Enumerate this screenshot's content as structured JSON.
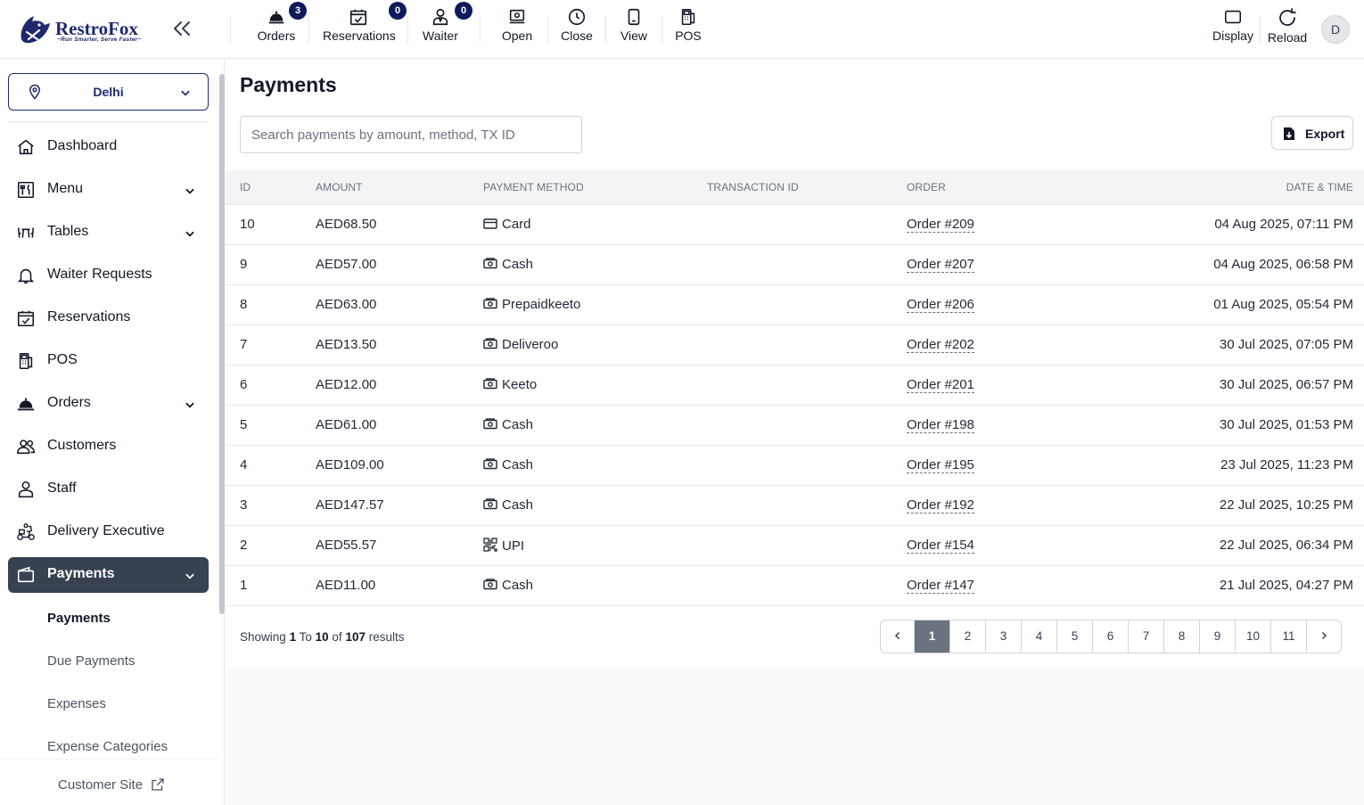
{
  "app": {
    "brand": "RestroFox",
    "tagline": "~Run Smarter, Serve Faster~"
  },
  "topbar": {
    "items": [
      {
        "label": "Orders",
        "icon": "bell-service-icon",
        "badge": "3"
      },
      {
        "label": "Reservations",
        "icon": "calendar-check-icon",
        "badge": "0"
      },
      {
        "label": "Waiter",
        "icon": "person-icon",
        "badge": "0"
      },
      {
        "label": "Open",
        "icon": "register-icon"
      },
      {
        "label": "Close",
        "icon": "clock-icon"
      },
      {
        "label": "View",
        "icon": "tablet-icon"
      },
      {
        "label": "POS",
        "icon": "pos-icon"
      }
    ],
    "display_label": "Display",
    "reload_label": "Reload",
    "avatar_initial": "D"
  },
  "sidebar": {
    "location": "Delhi",
    "items": [
      {
        "label": "Dashboard"
      },
      {
        "label": "Menu"
      },
      {
        "label": "Tables"
      },
      {
        "label": "Waiter Requests"
      },
      {
        "label": "Reservations"
      },
      {
        "label": "POS"
      },
      {
        "label": "Orders"
      },
      {
        "label": "Customers"
      },
      {
        "label": "Staff"
      },
      {
        "label": "Delivery Executive"
      },
      {
        "label": "Payments"
      }
    ],
    "sub_items": [
      {
        "label": "Payments"
      },
      {
        "label": "Due Payments"
      },
      {
        "label": "Expenses"
      },
      {
        "label": "Expense Categories"
      }
    ],
    "customer_site": "Customer Site"
  },
  "page": {
    "title": "Payments",
    "search_placeholder": "Search payments by amount, method, TX ID",
    "export_label": "Export"
  },
  "table": {
    "headers": [
      "ID",
      "AMOUNT",
      "PAYMENT METHOD",
      "TRANSACTION ID",
      "ORDER",
      "DATE & TIME"
    ],
    "rows": [
      {
        "id": "10",
        "amount": "AED68.50",
        "method": "Card",
        "method_icon": "card-icon",
        "tx": "",
        "order": "Order #209",
        "datetime": "04 Aug 2025, 07:11 PM"
      },
      {
        "id": "9",
        "amount": "AED57.00",
        "method": "Cash",
        "method_icon": "cash-icon",
        "tx": "",
        "order": "Order #207",
        "datetime": "04 Aug 2025, 06:58 PM"
      },
      {
        "id": "8",
        "amount": "AED63.00",
        "method": "Prepaidkeeto",
        "method_icon": "cash-icon",
        "tx": "",
        "order": "Order #206",
        "datetime": "01 Aug 2025, 05:54 PM"
      },
      {
        "id": "7",
        "amount": "AED13.50",
        "method": "Deliveroo",
        "method_icon": "cash-icon",
        "tx": "",
        "order": "Order #202",
        "datetime": "30 Jul 2025, 07:05 PM"
      },
      {
        "id": "6",
        "amount": "AED12.00",
        "method": "Keeto",
        "method_icon": "cash-icon",
        "tx": "",
        "order": "Order #201",
        "datetime": "30 Jul 2025, 06:57 PM"
      },
      {
        "id": "5",
        "amount": "AED61.00",
        "method": "Cash",
        "method_icon": "cash-icon",
        "tx": "",
        "order": "Order #198",
        "datetime": "30 Jul 2025, 01:53 PM"
      },
      {
        "id": "4",
        "amount": "AED109.00",
        "method": "Cash",
        "method_icon": "cash-icon",
        "tx": "",
        "order": "Order #195",
        "datetime": "23 Jul 2025, 11:23 PM"
      },
      {
        "id": "3",
        "amount": "AED147.57",
        "method": "Cash",
        "method_icon": "cash-icon",
        "tx": "",
        "order": "Order #192",
        "datetime": "22 Jul 2025, 10:25 PM"
      },
      {
        "id": "2",
        "amount": "AED55.57",
        "method": "UPI",
        "method_icon": "qr-icon",
        "tx": "",
        "order": "Order #154",
        "datetime": "22 Jul 2025, 06:34 PM"
      },
      {
        "id": "1",
        "amount": "AED11.00",
        "method": "Cash",
        "method_icon": "cash-icon",
        "tx": "",
        "order": "Order #147",
        "datetime": "21 Jul 2025, 04:27 PM"
      }
    ]
  },
  "pagination": {
    "showing_prefix": "Showing",
    "from": "1",
    "to_word": "To",
    "to": "10",
    "of_word": "of",
    "total": "107",
    "suffix": "results",
    "pages": [
      "1",
      "2",
      "3",
      "4",
      "5",
      "6",
      "7",
      "8",
      "9",
      "10",
      "11"
    ],
    "current": "1"
  },
  "colors": {
    "brand": "#1e2a6b",
    "active_nav": "#374151",
    "badge": "#0f1a5c"
  }
}
